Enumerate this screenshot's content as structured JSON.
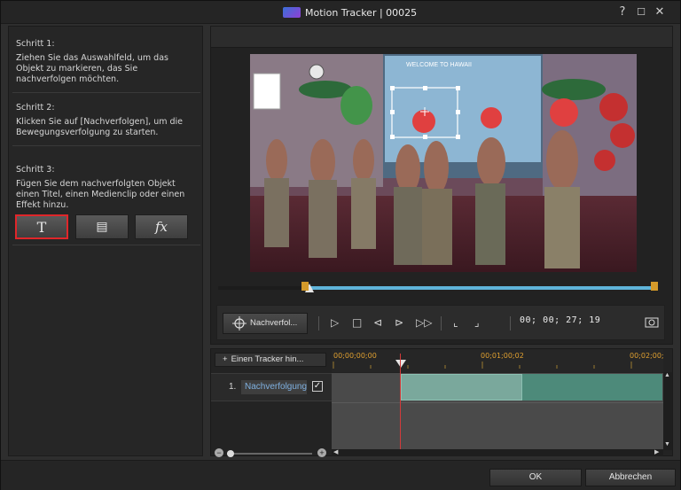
{
  "window": {
    "title": "Motion Tracker | 00025",
    "help": "?",
    "maximize": "☐",
    "close": "✕"
  },
  "steps": [
    {
      "heading": "Schritt 1:",
      "text": "Ziehen Sie das Auswahlfeld, um das Objekt zu markieren, das Sie nachverfolgen möchten."
    },
    {
      "heading": "Schritt 2:",
      "text": "Klicken Sie auf [Nachverfolgen], um die Bewegungsverfolgung zu starten."
    },
    {
      "heading": "Schritt 3:",
      "text": "Fügen Sie dem nachverfolgten Objekt einen Titel, einen Medienclip oder einen Effekt hinzu."
    }
  ],
  "object_buttons": {
    "title": "T",
    "media": "▤",
    "effect": "fx"
  },
  "video": {
    "banner": "WELCOME TO HAWAII"
  },
  "controls": {
    "track_button": "Nachverfol...",
    "timecode": "00; 00; 27; 19"
  },
  "timeline": {
    "add_tracker": "Einen Tracker hin...",
    "ruler_labels": [
      "00;00;00;00",
      "00;01;00;02",
      "00;02;00;"
    ],
    "tracks": [
      {
        "index": "1.",
        "name": "Nachverfolgung",
        "checked": true
      }
    ]
  },
  "footer": {
    "ok": "OK",
    "cancel": "Abbrechen"
  },
  "colors": {
    "accent": "#5fb4da",
    "selected_border": "#e0262a",
    "clip": "#7aa89c",
    "timecode_ruler": "#e0a030"
  }
}
